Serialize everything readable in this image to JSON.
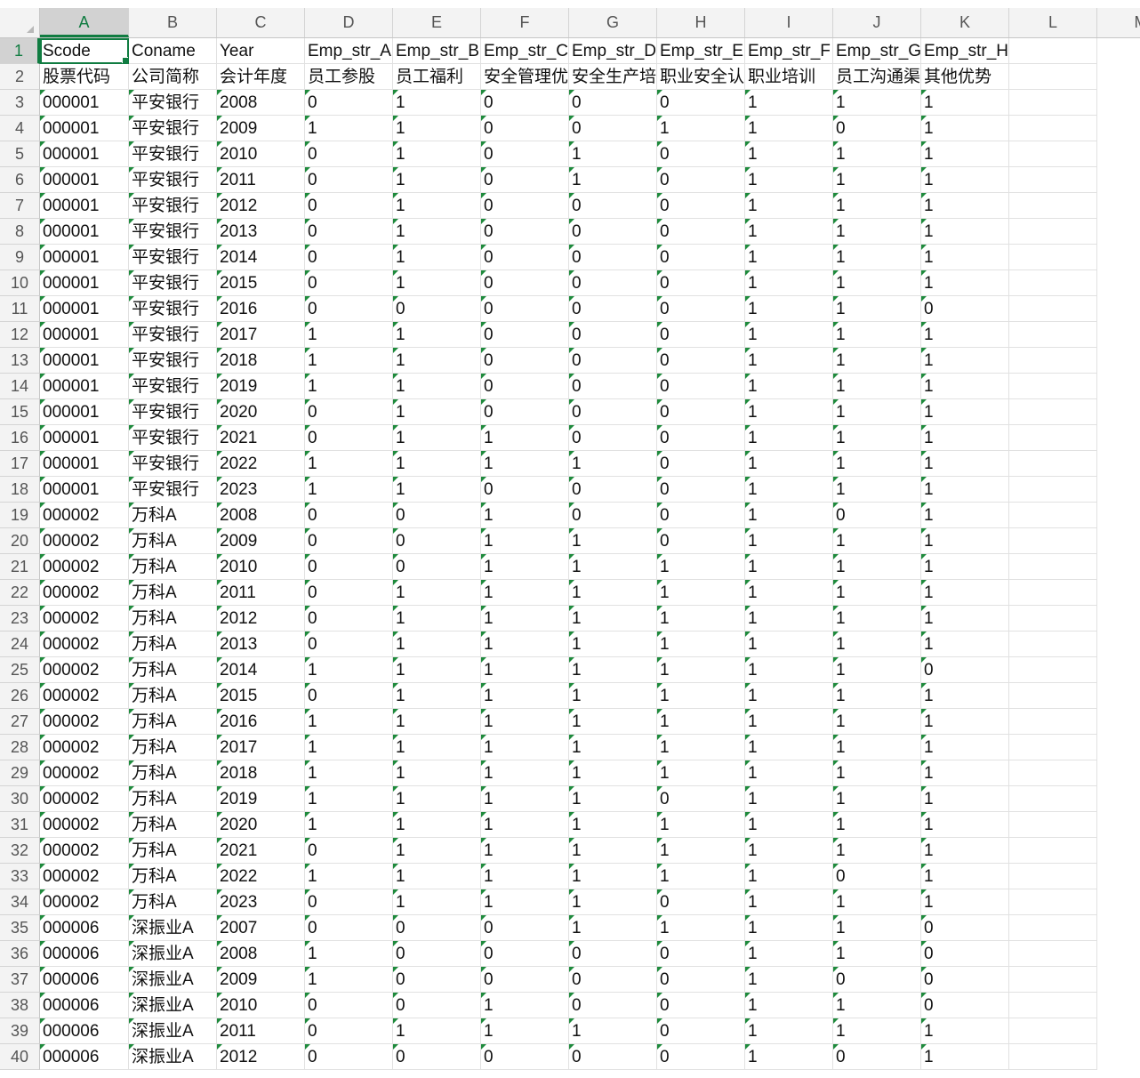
{
  "sheet": {
    "active_cell": "A1",
    "columns": [
      "A",
      "B",
      "C",
      "D",
      "E",
      "F",
      "G",
      "H",
      "I",
      "J",
      "K",
      "L",
      "M"
    ],
    "header_row": [
      "Scode",
      "Coname",
      "Year",
      "Emp_str_A",
      "Emp_str_B",
      "Emp_str_C",
      "Emp_str_D",
      "Emp_str_E",
      "Emp_str_F",
      "Emp_str_G",
      "Emp_str_H"
    ],
    "label_row": [
      "股票代码",
      "公司简称",
      "会计年度",
      "员工参股",
      "员工福利",
      "安全管理优势",
      "安全生产培训",
      "职业安全认证",
      "职业培训",
      "员工沟通渠道",
      "其他优势"
    ],
    "rows": [
      [
        "000001",
        "平安银行",
        "2008",
        "0",
        "1",
        "0",
        "0",
        "0",
        "1",
        "1",
        "1"
      ],
      [
        "000001",
        "平安银行",
        "2009",
        "1",
        "1",
        "0",
        "0",
        "1",
        "1",
        "0",
        "1"
      ],
      [
        "000001",
        "平安银行",
        "2010",
        "0",
        "1",
        "0",
        "1",
        "0",
        "1",
        "1",
        "1"
      ],
      [
        "000001",
        "平安银行",
        "2011",
        "0",
        "1",
        "0",
        "1",
        "0",
        "1",
        "1",
        "1"
      ],
      [
        "000001",
        "平安银行",
        "2012",
        "0",
        "1",
        "0",
        "0",
        "0",
        "1",
        "1",
        "1"
      ],
      [
        "000001",
        "平安银行",
        "2013",
        "0",
        "1",
        "0",
        "0",
        "0",
        "1",
        "1",
        "1"
      ],
      [
        "000001",
        "平安银行",
        "2014",
        "0",
        "1",
        "0",
        "0",
        "0",
        "1",
        "1",
        "1"
      ],
      [
        "000001",
        "平安银行",
        "2015",
        "0",
        "1",
        "0",
        "0",
        "0",
        "1",
        "1",
        "1"
      ],
      [
        "000001",
        "平安银行",
        "2016",
        "0",
        "0",
        "0",
        "0",
        "0",
        "1",
        "1",
        "0"
      ],
      [
        "000001",
        "平安银行",
        "2017",
        "1",
        "1",
        "0",
        "0",
        "0",
        "1",
        "1",
        "1"
      ],
      [
        "000001",
        "平安银行",
        "2018",
        "1",
        "1",
        "0",
        "0",
        "0",
        "1",
        "1",
        "1"
      ],
      [
        "000001",
        "平安银行",
        "2019",
        "1",
        "1",
        "0",
        "0",
        "0",
        "1",
        "1",
        "1"
      ],
      [
        "000001",
        "平安银行",
        "2020",
        "0",
        "1",
        "0",
        "0",
        "0",
        "1",
        "1",
        "1"
      ],
      [
        "000001",
        "平安银行",
        "2021",
        "0",
        "1",
        "1",
        "0",
        "0",
        "1",
        "1",
        "1"
      ],
      [
        "000001",
        "平安银行",
        "2022",
        "1",
        "1",
        "1",
        "1",
        "0",
        "1",
        "1",
        "1"
      ],
      [
        "000001",
        "平安银行",
        "2023",
        "1",
        "1",
        "0",
        "0",
        "0",
        "1",
        "1",
        "1"
      ],
      [
        "000002",
        "万科A",
        "2008",
        "0",
        "0",
        "1",
        "0",
        "0",
        "1",
        "0",
        "1"
      ],
      [
        "000002",
        "万科A",
        "2009",
        "0",
        "0",
        "1",
        "1",
        "0",
        "1",
        "1",
        "1"
      ],
      [
        "000002",
        "万科A",
        "2010",
        "0",
        "0",
        "1",
        "1",
        "1",
        "1",
        "1",
        "1"
      ],
      [
        "000002",
        "万科A",
        "2011",
        "0",
        "1",
        "1",
        "1",
        "1",
        "1",
        "1",
        "1"
      ],
      [
        "000002",
        "万科A",
        "2012",
        "0",
        "1",
        "1",
        "1",
        "1",
        "1",
        "1",
        "1"
      ],
      [
        "000002",
        "万科A",
        "2013",
        "0",
        "1",
        "1",
        "1",
        "1",
        "1",
        "1",
        "1"
      ],
      [
        "000002",
        "万科A",
        "2014",
        "1",
        "1",
        "1",
        "1",
        "1",
        "1",
        "1",
        "0"
      ],
      [
        "000002",
        "万科A",
        "2015",
        "0",
        "1",
        "1",
        "1",
        "1",
        "1",
        "1",
        "1"
      ],
      [
        "000002",
        "万科A",
        "2016",
        "1",
        "1",
        "1",
        "1",
        "1",
        "1",
        "1",
        "1"
      ],
      [
        "000002",
        "万科A",
        "2017",
        "1",
        "1",
        "1",
        "1",
        "1",
        "1",
        "1",
        "1"
      ],
      [
        "000002",
        "万科A",
        "2018",
        "1",
        "1",
        "1",
        "1",
        "1",
        "1",
        "1",
        "1"
      ],
      [
        "000002",
        "万科A",
        "2019",
        "1",
        "1",
        "1",
        "1",
        "0",
        "1",
        "1",
        "1"
      ],
      [
        "000002",
        "万科A",
        "2020",
        "1",
        "1",
        "1",
        "1",
        "1",
        "1",
        "1",
        "1"
      ],
      [
        "000002",
        "万科A",
        "2021",
        "0",
        "1",
        "1",
        "1",
        "1",
        "1",
        "1",
        "1"
      ],
      [
        "000002",
        "万科A",
        "2022",
        "1",
        "1",
        "1",
        "1",
        "1",
        "1",
        "0",
        "1"
      ],
      [
        "000002",
        "万科A",
        "2023",
        "0",
        "1",
        "1",
        "1",
        "0",
        "1",
        "1",
        "1"
      ],
      [
        "000006",
        "深振业A",
        "2007",
        "0",
        "0",
        "0",
        "1",
        "1",
        "1",
        "1",
        "0"
      ],
      [
        "000006",
        "深振业A",
        "2008",
        "1",
        "0",
        "0",
        "0",
        "0",
        "1",
        "1",
        "0"
      ],
      [
        "000006",
        "深振业A",
        "2009",
        "1",
        "0",
        "0",
        "0",
        "0",
        "1",
        "0",
        "0"
      ],
      [
        "000006",
        "深振业A",
        "2010",
        "0",
        "0",
        "1",
        "0",
        "0",
        "1",
        "1",
        "0"
      ],
      [
        "000006",
        "深振业A",
        "2011",
        "0",
        "1",
        "1",
        "1",
        "0",
        "1",
        "1",
        "1"
      ],
      [
        "000006",
        "深振业A",
        "2012",
        "0",
        "0",
        "0",
        "0",
        "0",
        "1",
        "0",
        "1"
      ]
    ]
  },
  "colors": {
    "accent": "#107c41",
    "text_marker": "#1e8a3c",
    "header_bg": "#f3f3f3",
    "grid": "#e1e1e1"
  }
}
